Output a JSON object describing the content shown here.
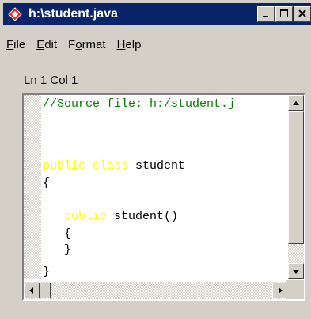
{
  "window": {
    "title": "h:\\student.java",
    "icon": "java-diamond-icon",
    "buttons": [
      "minimize-icon",
      "maximize-icon",
      "close-icon"
    ]
  },
  "menu": [
    {
      "underline": "F",
      "rest": "ile"
    },
    {
      "underline": "E",
      "rest": "dit"
    },
    {
      "pre": "F",
      "underline": "o",
      "rest": "rmat"
    },
    {
      "underline": "H",
      "rest": "elp"
    }
  ],
  "status": "Ln 1 Col 1",
  "code": {
    "line1": "//Source file: h:/student.j",
    "line2_kw": "public class",
    "line2_rest": " student",
    "line3": "{",
    "line4_kw": "public",
    "line4_rest": " student()",
    "line5": "{",
    "line6": "}",
    "line7": "}"
  },
  "colors": {
    "comment": "#008000",
    "keyword": "#ffff00",
    "titlebar": "#0a246a"
  }
}
